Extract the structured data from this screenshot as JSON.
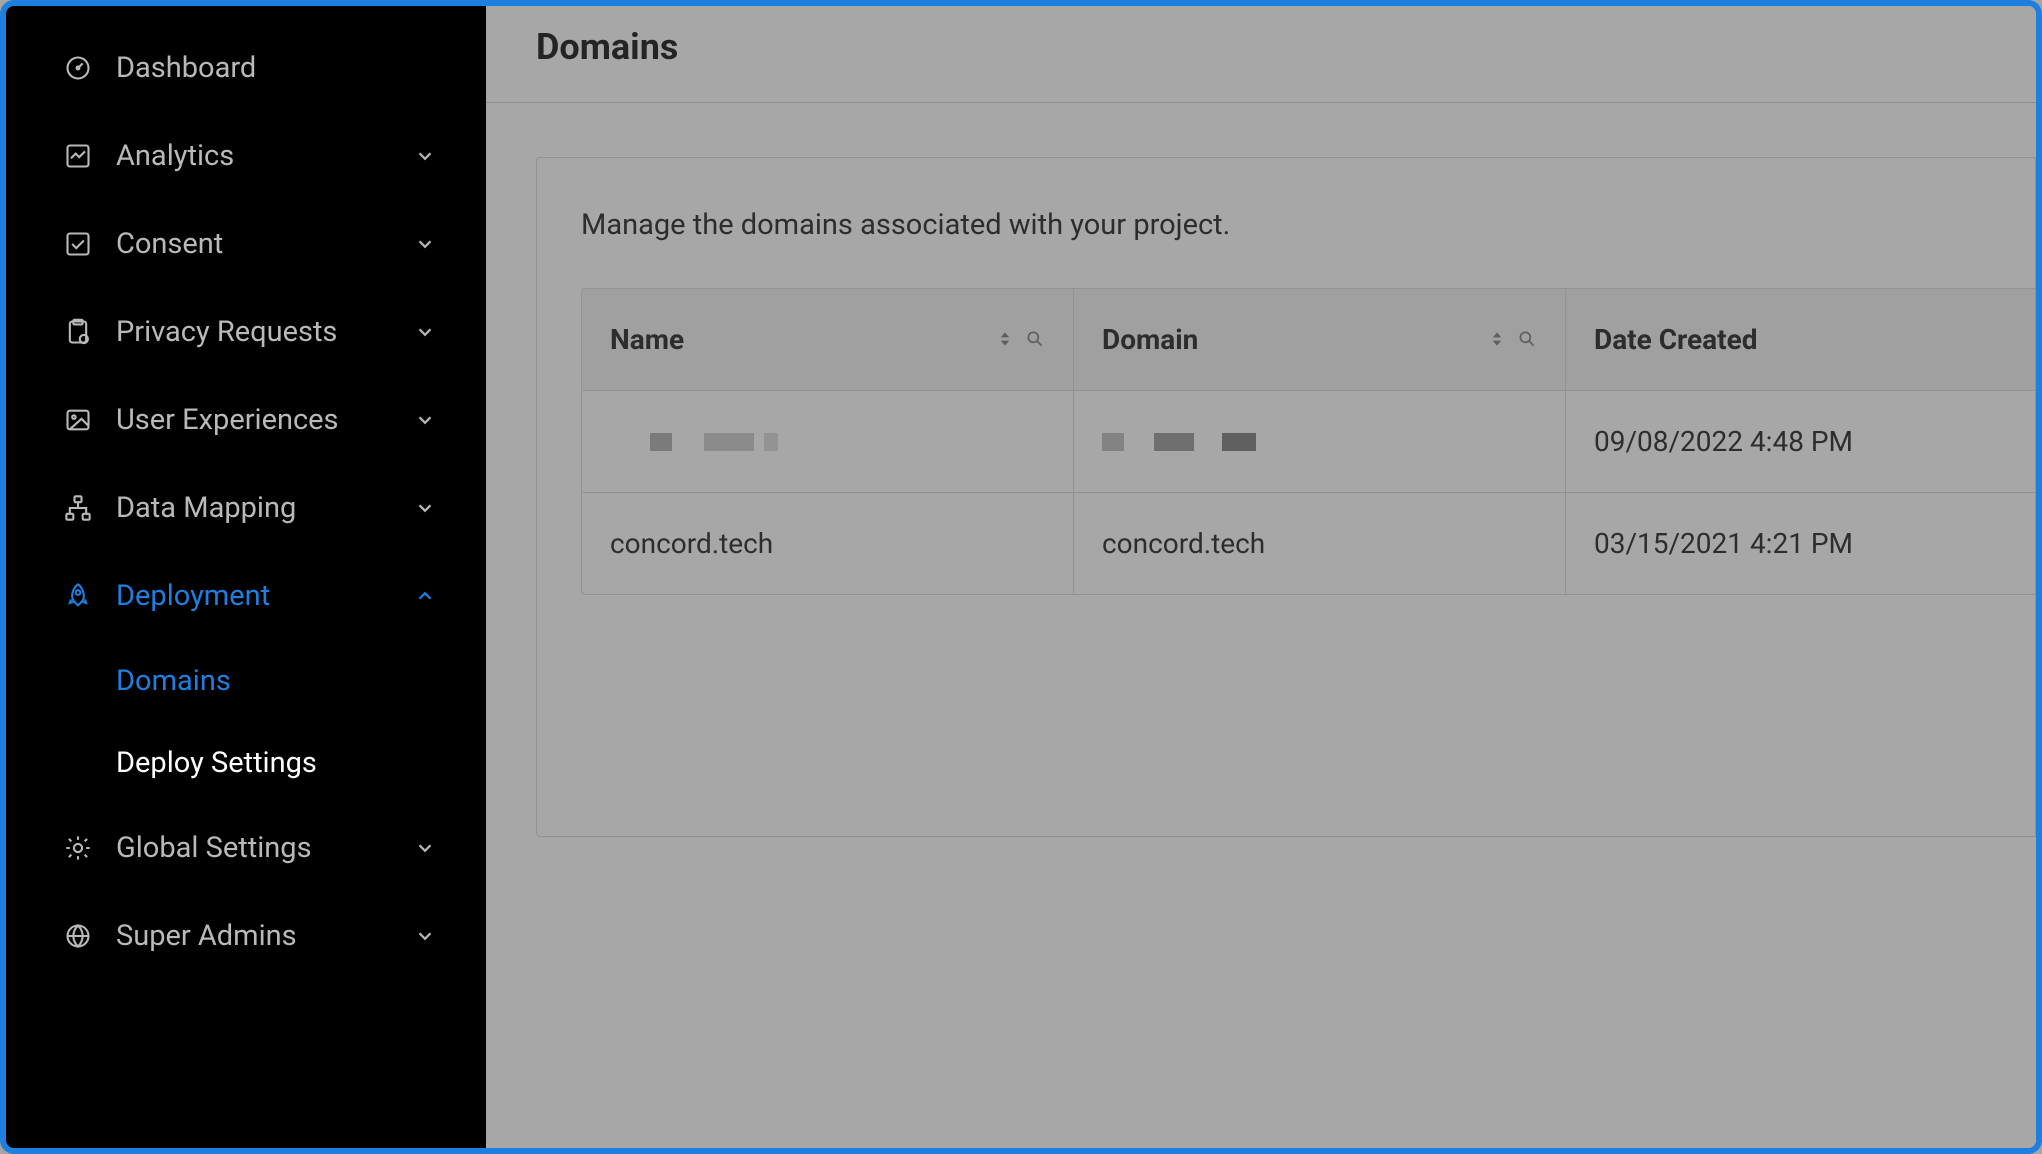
{
  "sidebar": {
    "items": [
      {
        "label": "Dashboard",
        "icon": "gauge-icon",
        "expandable": false
      },
      {
        "label": "Analytics",
        "icon": "chart-icon",
        "expandable": true
      },
      {
        "label": "Consent",
        "icon": "checkbox-icon",
        "expandable": true
      },
      {
        "label": "Privacy Requests",
        "icon": "clipboard-icon",
        "expandable": true
      },
      {
        "label": "User Experiences",
        "icon": "image-icon",
        "expandable": true
      },
      {
        "label": "Data Mapping",
        "icon": "sitemap-icon",
        "expandable": true
      },
      {
        "label": "Deployment",
        "icon": "rocket-icon",
        "expandable": true,
        "active": true,
        "children": [
          {
            "label": "Domains",
            "active": true
          },
          {
            "label": "Deploy Settings"
          }
        ]
      },
      {
        "label": "Global Settings",
        "icon": "gear-icon",
        "expandable": true
      },
      {
        "label": "Super Admins",
        "icon": "globe-icon",
        "expandable": true
      }
    ]
  },
  "main": {
    "title": "Domains",
    "description": "Manage the domains associated with your project.",
    "table": {
      "columns": [
        "Name",
        "Domain",
        "Date Created"
      ],
      "rows": [
        {
          "name": "[redacted]",
          "domain": "[redacted]",
          "date": "09/08/2022 4:48 PM",
          "redacted": true
        },
        {
          "name": "concord.tech",
          "domain": "concord.tech",
          "date": "03/15/2021 4:21 PM"
        }
      ]
    }
  }
}
